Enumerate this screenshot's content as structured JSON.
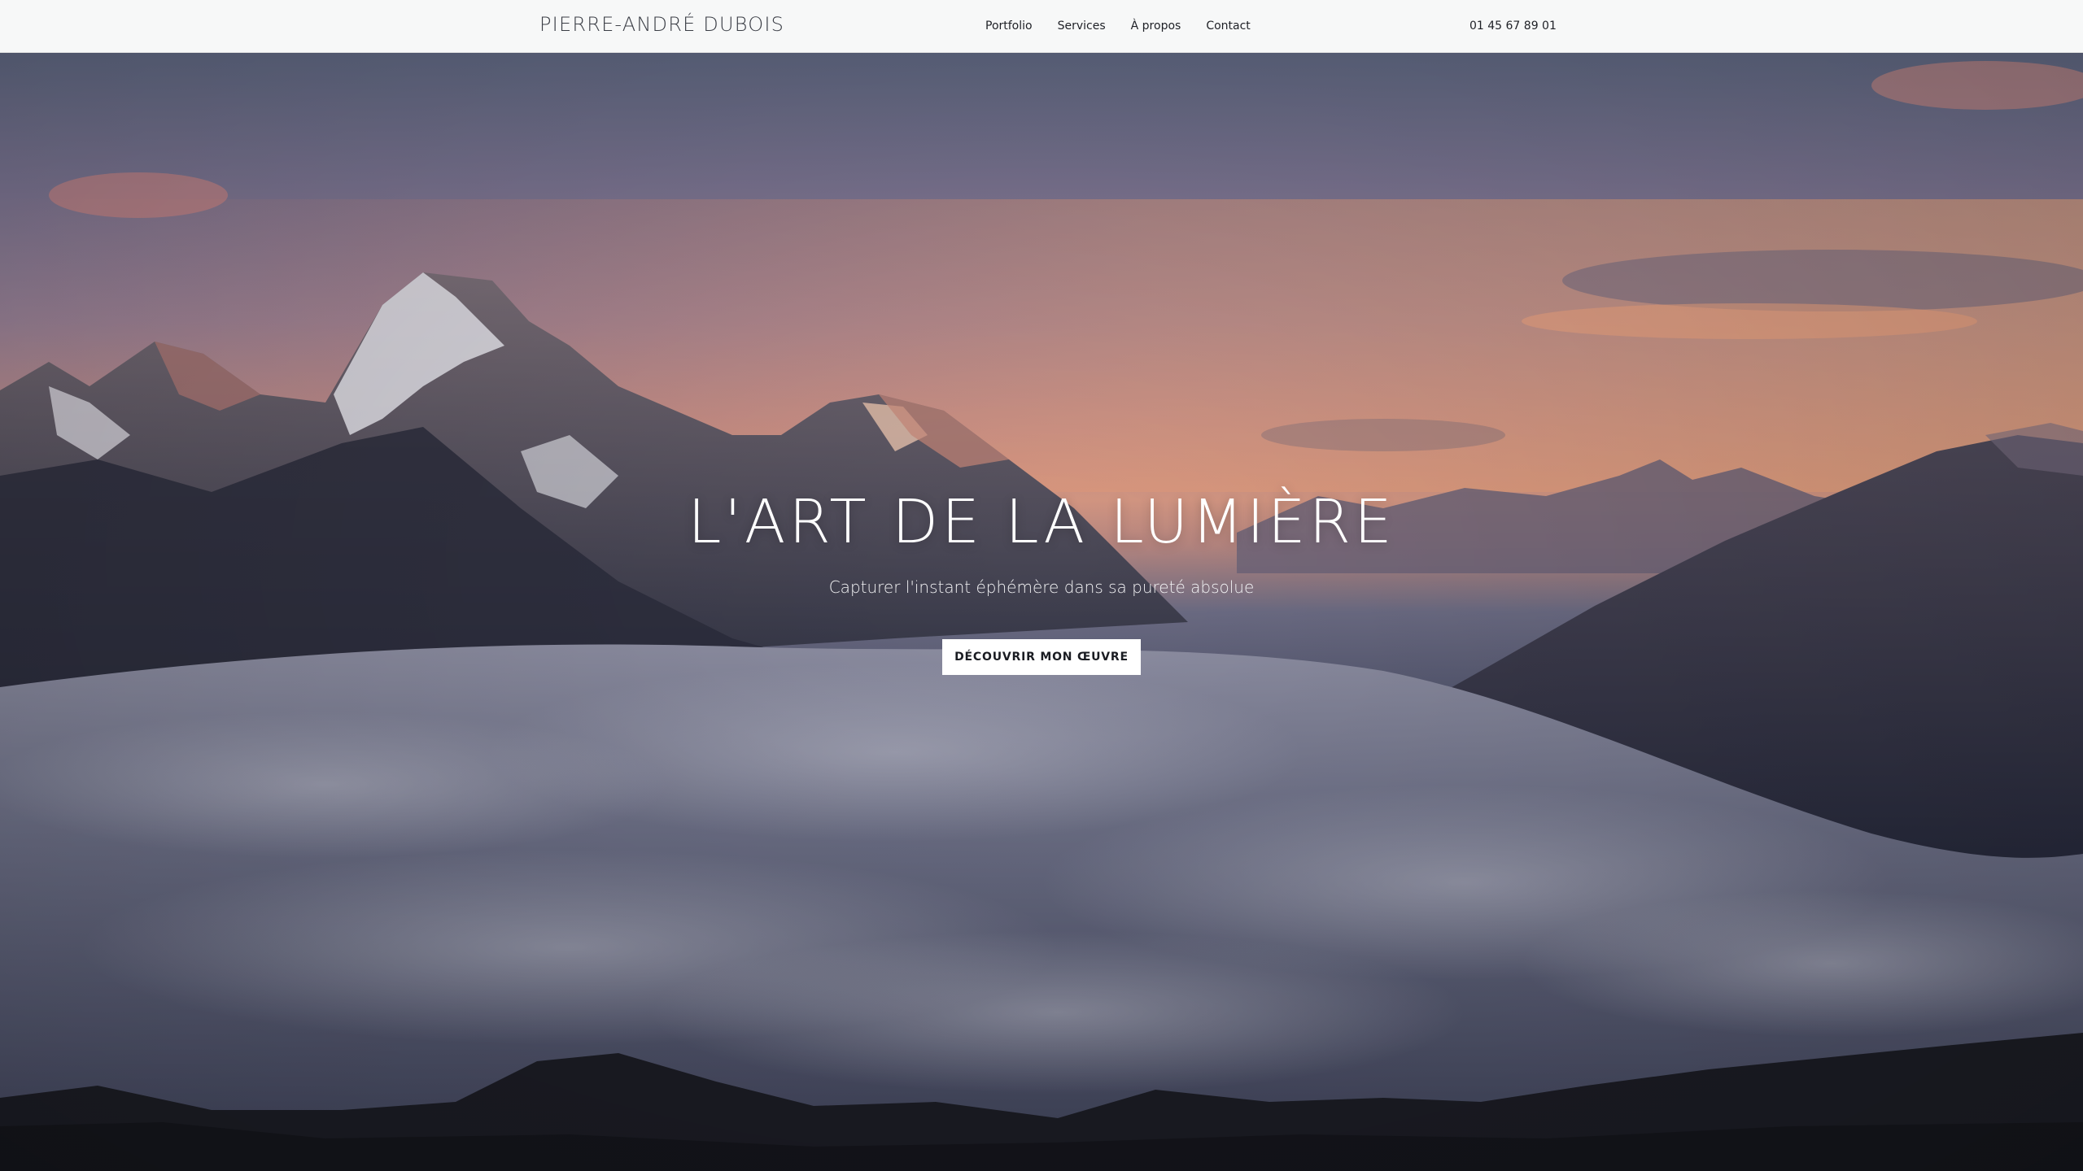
{
  "header": {
    "brand": "PIERRE-ANDRÉ DUBOIS",
    "nav": [
      {
        "label": "Portfolio"
      },
      {
        "label": "Services"
      },
      {
        "label": "À propos"
      },
      {
        "label": "Contact"
      }
    ],
    "phone": "01 45 67 89 01"
  },
  "hero": {
    "title": "L'ART DE LA LUMIÈRE",
    "subtitle": "Capturer l'instant éphémère dans sa pureté absolue",
    "cta_label": "DÉCOUVRIR MON ŒUVRE",
    "background": "mountain-sea-of-clouds-sunset-photo"
  },
  "colors": {
    "header_bg": "#f7f8f8",
    "text_dark": "#1e2026",
    "hero_text": "#ffffff",
    "cta_bg": "#ffffff"
  }
}
